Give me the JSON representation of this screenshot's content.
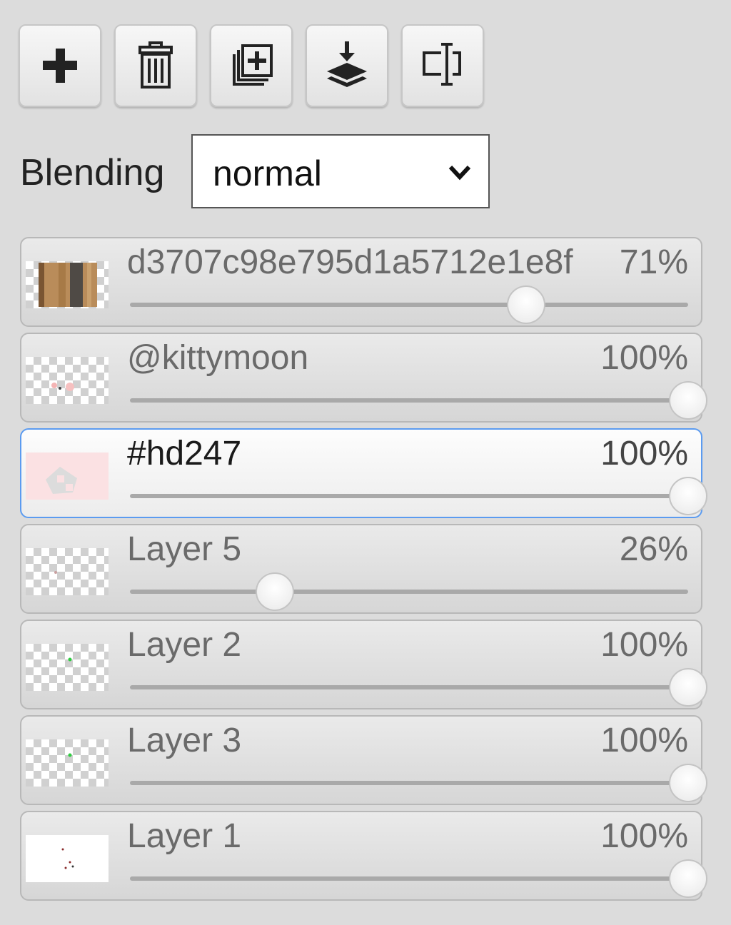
{
  "toolbar": {
    "buttons": [
      {
        "name": "add-layer",
        "icon": "plus-icon"
      },
      {
        "name": "delete-layer",
        "icon": "trash-icon"
      },
      {
        "name": "duplicate-layer",
        "icon": "duplicate-icon"
      },
      {
        "name": "merge-down",
        "icon": "merge-down-icon"
      },
      {
        "name": "rename-layer",
        "icon": "rename-icon"
      }
    ]
  },
  "blending": {
    "label": "Blending",
    "selected": "normal"
  },
  "layers": [
    {
      "name": "d3707c98e795d1a5712e1e8f",
      "opacity_label": "71%",
      "opacity": 0.71,
      "selected": false,
      "thumb": "wood"
    },
    {
      "name": "@kittymoon",
      "opacity_label": "100%",
      "opacity": 1.0,
      "selected": false,
      "thumb": "checker-pink-dots"
    },
    {
      "name": "#hd247",
      "opacity_label": "100%",
      "opacity": 1.0,
      "selected": true,
      "thumb": "pink-shape"
    },
    {
      "name": "Layer 5",
      "opacity_label": "26%",
      "opacity": 0.26,
      "selected": false,
      "thumb": "checker"
    },
    {
      "name": "Layer 2",
      "opacity_label": "100%",
      "opacity": 1.0,
      "selected": false,
      "thumb": "checker-green-dot"
    },
    {
      "name": "Layer 3",
      "opacity_label": "100%",
      "opacity": 1.0,
      "selected": false,
      "thumb": "checker-green-dot"
    },
    {
      "name": "Layer 1",
      "opacity_label": "100%",
      "opacity": 1.0,
      "selected": false,
      "thumb": "white-dots"
    }
  ],
  "colors": {
    "selected_border": "#5b9bf0",
    "panel_bg": "#dcdcdc"
  }
}
